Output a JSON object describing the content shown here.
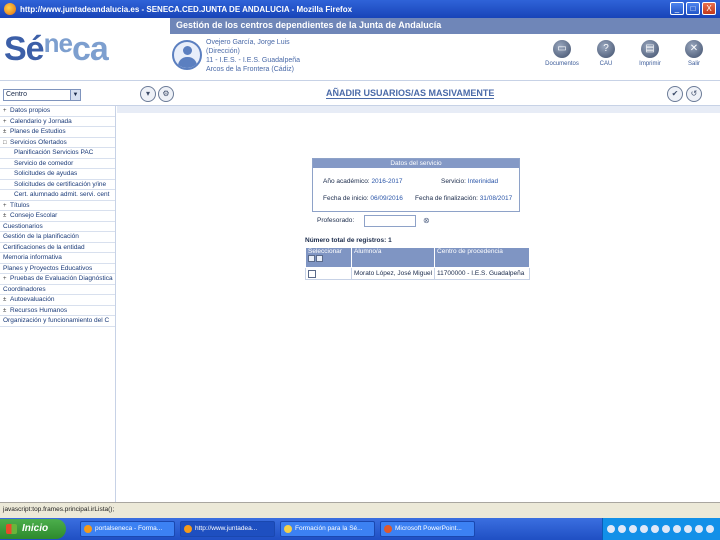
{
  "window": {
    "title": "http://www.juntadeandalucia.es - SENECA.CED.JUNTA DE ANDALUCIA - Mozilla Firefox",
    "min_label": "_",
    "max_label": "□",
    "close_label": "X"
  },
  "header": {
    "band_title": "Gestión de los centros dependientes de la Junta de Andalucía",
    "logo": "Séneca",
    "user_lines": [
      "Ovejero García, Jorge Luis",
      "(Dirección)",
      "11 - I.E.S. - I.E.S. Guadalpeña",
      "Arcos de la Frontera (Cádiz)"
    ],
    "tools": [
      {
        "label": "Documentos",
        "icon": "documents-icon",
        "glyph": "▭"
      },
      {
        "label": "CAU",
        "icon": "cau-icon",
        "glyph": "?"
      },
      {
        "label": "Imprimir",
        "icon": "print-icon",
        "glyph": "▤"
      },
      {
        "label": "Salir",
        "icon": "exit-icon",
        "glyph": "✕"
      }
    ]
  },
  "navbar": {
    "centro_value": "Centro",
    "page_title": "AÑADIR USUARIOS/AS MASIVAMENTE",
    "nav_glyphs": [
      "▾",
      "⚙",
      "✔",
      "↺"
    ]
  },
  "sidebar": {
    "items": [
      {
        "label": "Datos propios",
        "toggle": "+",
        "level": 0
      },
      {
        "label": "Calendario y Jornada",
        "toggle": "+",
        "level": 0
      },
      {
        "label": "Planes de Estudios",
        "toggle": "±",
        "level": 0
      },
      {
        "label": "Servicios Ofertados",
        "toggle": "□",
        "level": 0
      },
      {
        "label": "Planificación Servicios PAC",
        "toggle": "",
        "level": 1
      },
      {
        "label": "Servicio de comedor",
        "toggle": "",
        "level": 1
      },
      {
        "label": "Solicitudes de ayudas",
        "toggle": "",
        "level": 1
      },
      {
        "label": "Solicitudes de certificación y/ine",
        "toggle": "",
        "level": 1
      },
      {
        "label": "Cert. alumnado admit. servi. cent",
        "toggle": "",
        "level": 1
      },
      {
        "label": "Títulos",
        "toggle": "+",
        "level": 0
      },
      {
        "label": "Consejo Escolar",
        "toggle": "±",
        "level": 0
      },
      {
        "label": "Cuestionarios",
        "toggle": "",
        "level": 0
      },
      {
        "label": "Gestión de la planificación",
        "toggle": "",
        "level": 0
      },
      {
        "label": "Certificaciones de la entidad",
        "toggle": "",
        "level": 0
      },
      {
        "label": "Memoria informativa",
        "toggle": "",
        "level": 0
      },
      {
        "label": "Planes y Proyectos Educativos",
        "toggle": "",
        "level": 0
      },
      {
        "label": "Pruebas de Evaluación Diagnóstica",
        "toggle": "+",
        "level": 0
      },
      {
        "label": "Coordinadores",
        "toggle": "",
        "level": 0
      },
      {
        "label": "Autoevaluación",
        "toggle": "±",
        "level": 0
      },
      {
        "label": "Recursos Humanos",
        "toggle": "±",
        "level": 0
      },
      {
        "label": "Organización y funcionamiento del C",
        "toggle": "",
        "level": 0
      }
    ]
  },
  "infobox": {
    "heading": "Datos del servicio",
    "anio_label": "Año académico:",
    "anio_value": "2016-2017",
    "servicio_label": "Servicio:",
    "servicio_value": "Interinidad",
    "fecha_ini_label": "Fecha de inicio:",
    "fecha_ini_value": "06/09/2016",
    "fecha_fin_label": "Fecha de finalización:",
    "fecha_fin_value": "31/08/2017"
  },
  "filter": {
    "label": "Profesorado:",
    "value": "",
    "icon_glyph": "⊗"
  },
  "results": {
    "total_text": "Número total de registros: 1",
    "headers": [
      "Seleccionar",
      "Alumno/a",
      "Centro de procedencia"
    ],
    "rows": [
      {
        "alumno": "Morato López, José Miguel",
        "centro": "11700000 - I.E.S. Guadalpeña"
      }
    ]
  },
  "status_bar": "javascript:top.frames.principal.irLista(); ",
  "taskbar": {
    "start_label": "Inicio",
    "tasks": [
      {
        "label": "portalseneca - Forma...",
        "active": false
      },
      {
        "label": "http://www.juntadea...",
        "active": true
      },
      {
        "label": "Formación para la Sé...",
        "active": false
      },
      {
        "label": "Microsoft PowerPoint...",
        "active": false
      }
    ]
  }
}
